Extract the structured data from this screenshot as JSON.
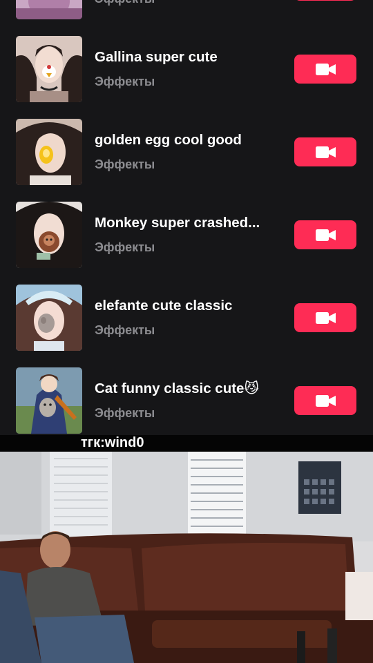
{
  "effects_list": {
    "items": [
      {
        "title": "",
        "subtitle": "Эффекты"
      },
      {
        "title": "Gallina super cute",
        "subtitle": "Эффекты"
      },
      {
        "title": "golden egg cool good",
        "subtitle": "Эффекты"
      },
      {
        "title": "Monkey super crashed...",
        "subtitle": "Эффекты"
      },
      {
        "title": "elefante cute classic",
        "subtitle": "Эффекты"
      },
      {
        "title": "Cat funny classic cute😼",
        "subtitle": "Эффекты"
      }
    ],
    "record_icon": "video-camera-icon"
  },
  "watermark": {
    "text": "тгк:wind0"
  },
  "colors": {
    "background": "#161618",
    "accent": "#fe2c55",
    "title": "#ffffff",
    "subtitle": "#8c8c90"
  }
}
